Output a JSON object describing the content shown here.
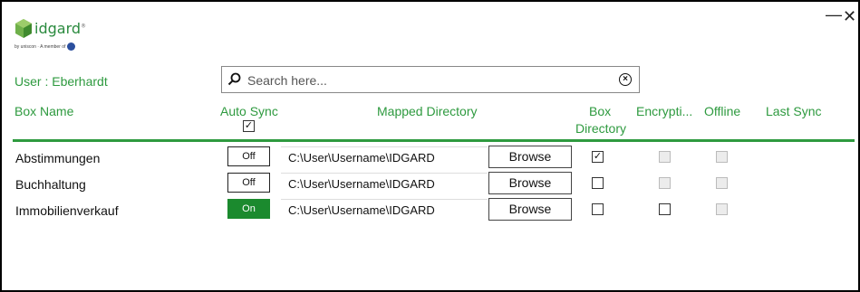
{
  "window": {
    "minimize": "—",
    "close": "✕"
  },
  "logo": {
    "brand": "idgard",
    "mark": "®",
    "tagline": "by uniscon · A member of"
  },
  "user_label": "User : Eberhardt",
  "search": {
    "placeholder": "Search here...",
    "clear": "×"
  },
  "columns": {
    "box_name": "Box Name",
    "auto_sync": "Auto Sync",
    "mapped_directory": "Mapped Directory",
    "box_directory_1": "Box",
    "box_directory_2": "Directory",
    "encryption": "Encrypti...",
    "offline": "Offline",
    "last_sync": "Last Sync"
  },
  "header_auto_sync_checked": true,
  "rows": [
    {
      "name": "Abstimmungen",
      "toggle": "Off",
      "path": "C:\\User\\Username\\IDGARD",
      "browse": "Browse",
      "box_dir": true,
      "encryption": false,
      "offline": false
    },
    {
      "name": "Buchhaltung",
      "toggle": "Off",
      "path": "C:\\User\\Username\\IDGARD",
      "browse": "Browse",
      "box_dir": false,
      "encryption": false,
      "offline": false
    },
    {
      "name": "Immobilienverkauf",
      "toggle": "On",
      "path": "C:\\User\\Username\\IDGARD",
      "browse": "Browse",
      "box_dir": false,
      "encryption": false,
      "offline": false
    }
  ],
  "colors": {
    "accent": "#2e9a3f",
    "on_toggle": "#1b8a2e"
  }
}
